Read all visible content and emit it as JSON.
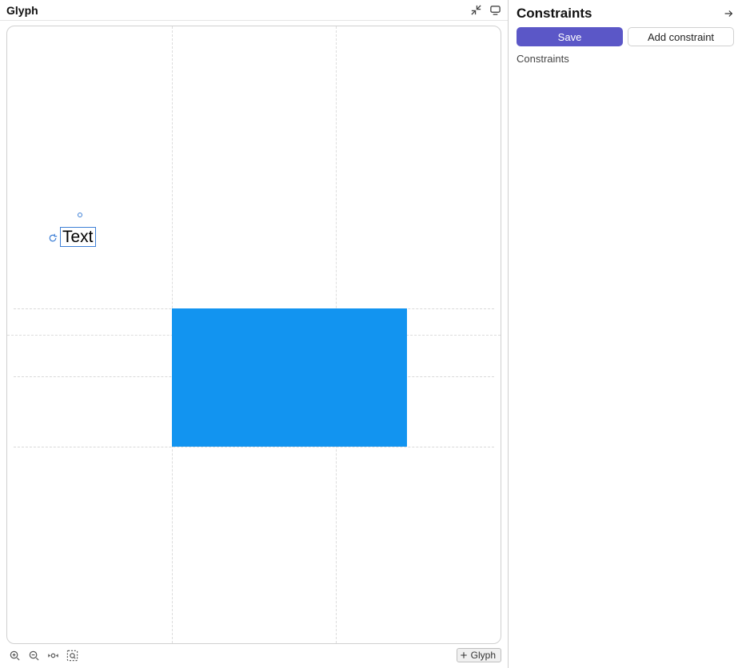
{
  "main": {
    "title": "Glyph",
    "footer_chip_label": "Glyph"
  },
  "canvas": {
    "text_mark": "Text"
  },
  "side": {
    "title": "Constraints",
    "save_label": "Save",
    "add_label": "Add constraint",
    "list_heading": "Constraints"
  },
  "colors": {
    "accent": "#5b57c7",
    "shape": "#1294f0"
  }
}
